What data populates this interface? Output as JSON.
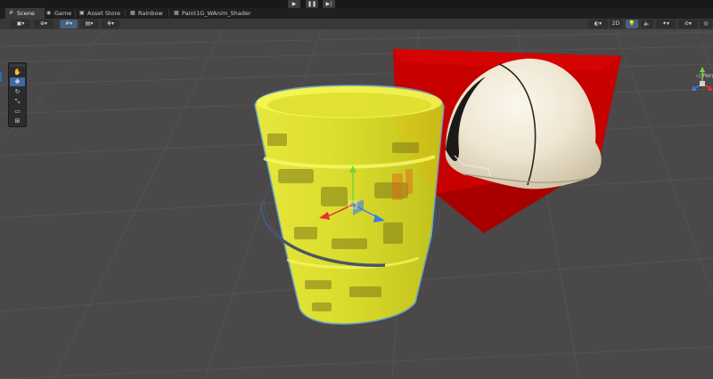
{
  "playbar": {
    "play_icon": "play-icon",
    "pause_icon": "pause-icon",
    "step_icon": "step-icon",
    "play_glyph": "▶",
    "pause_glyph": "❚❚",
    "step_glyph": "▶|"
  },
  "tabs": [
    {
      "label": "Scene",
      "icon": "scene-grid-icon",
      "glyph": "#"
    },
    {
      "label": "Game",
      "icon": "gamepad-icon",
      "glyph": "◉"
    },
    {
      "label": "Asset Store",
      "icon": "store-icon",
      "glyph": "▣"
    },
    {
      "label": "Rainbow",
      "icon": "shader-icon",
      "glyph": "▦"
    },
    {
      "label": "Paint1G_WAnim_Shader",
      "icon": "shader-icon",
      "glyph": "▦"
    }
  ],
  "toolbar": {
    "toggle_2d_label": "2D",
    "colors": {
      "selected": "#46607f"
    }
  },
  "tools": [
    {
      "name": "hand-tool",
      "glyph": "✋"
    },
    {
      "name": "move-tool",
      "glyph": "✥"
    },
    {
      "name": "rotate-tool",
      "glyph": "↻"
    },
    {
      "name": "scale-tool",
      "glyph": "⤡"
    },
    {
      "name": "rect-tool",
      "glyph": "▭"
    },
    {
      "name": "transform-tool",
      "glyph": "⊞"
    }
  ],
  "gizmo": {
    "projection_label": "◁ Persp",
    "colors": {
      "x": "#e8312f",
      "y": "#7ad13c",
      "z": "#3a7de8"
    }
  },
  "scene": {
    "colors": {
      "background": "#4a4848",
      "grid": "#5a5858",
      "cube": "#c60000",
      "bucket": "#eef02a",
      "helmet": "#efe8d8",
      "selection_outline": "#6fa7d6"
    }
  }
}
